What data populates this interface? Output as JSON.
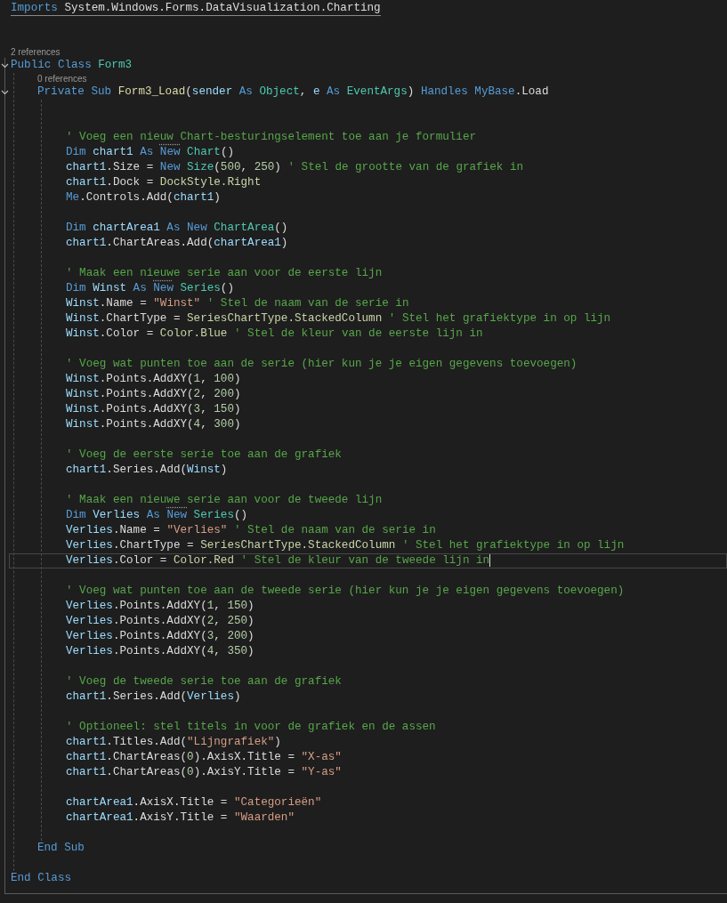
{
  "editor": {
    "lines": [
      {
        "kind": "import",
        "current": false,
        "tokens": [
          {
            "text": "Imports",
            "kind": "kw"
          },
          {
            "text": " System.Windows.Forms.DataVisualization.Charting",
            "kind": "plain"
          }
        ]
      },
      {
        "kind": "blank"
      },
      {
        "kind": "blank"
      },
      {
        "kind": "lens",
        "text": "2 references"
      },
      {
        "kind": "code",
        "current": false,
        "expanded": true,
        "tokens": [
          {
            "text": "Public Class ",
            "kind": "kw"
          },
          {
            "text": "Form3",
            "kind": "type"
          }
        ],
        "end": {
          "current": false,
          "tokens": [
            {
              "text": "End Class",
              "kind": "kw"
            }
          ]
        },
        "children": [
          {
            "kind": "lens",
            "text": "0 references"
          },
          {
            "kind": "code",
            "current": false,
            "expanded": true,
            "tokens": [
              {
                "text": "Private Sub ",
                "kind": "kw"
              },
              {
                "text": "Form3_Load",
                "kind": "fn"
              },
              {
                "text": "(",
                "kind": "plain"
              },
              {
                "text": "sender",
                "kind": "var"
              },
              {
                "text": " As ",
                "kind": "kw"
              },
              {
                "text": "Object",
                "kind": "type"
              },
              {
                "text": ", ",
                "kind": "plain"
              },
              {
                "text": "e",
                "kind": "var"
              },
              {
                "text": " As ",
                "kind": "kw"
              },
              {
                "text": "EventArgs",
                "kind": "type"
              },
              {
                "text": ") ",
                "kind": "plain"
              },
              {
                "text": "Handles MyBase",
                "kind": "kw"
              },
              {
                "text": ".Load",
                "kind": "plain"
              }
            ],
            "end": {
              "current": false,
              "tokens": [
                {
                  "text": "End Sub",
                  "kind": "kw"
                }
              ]
            },
            "children": [
              {
                "kind": "blank"
              },
              {
                "kind": "blank"
              },
              {
                "kind": "code",
                "current": false,
                "tokens": [
                  {
                    "text": "' Voeg een nieuw Chart-besturingselement toe aan je formulier",
                    "kind": "comment"
                  }
                ]
              },
              {
                "kind": "code",
                "current": false,
                "tokens": [
                  {
                    "text": "Dim ",
                    "kind": "kw"
                  },
                  {
                    "text": "chart1",
                    "kind": "var"
                  },
                  {
                    "text": " As ",
                    "kind": "kw"
                  },
                  {
                    "text": "New",
                    "kind": "hint"
                  },
                  {
                    "text": " Chart",
                    "kind": "type"
                  },
                  {
                    "text": "()",
                    "kind": "plain"
                  }
                ]
              },
              {
                "kind": "code",
                "current": false,
                "tokens": [
                  {
                    "text": "chart1",
                    "kind": "var"
                  },
                  {
                    "text": ".Size = ",
                    "kind": "plain"
                  },
                  {
                    "text": "New ",
                    "kind": "kw"
                  },
                  {
                    "text": "Size",
                    "kind": "type"
                  },
                  {
                    "text": "(",
                    "kind": "plain"
                  },
                  {
                    "text": "500",
                    "kind": "num"
                  },
                  {
                    "text": ", ",
                    "kind": "plain"
                  },
                  {
                    "text": "250",
                    "kind": "num"
                  },
                  {
                    "text": ") ",
                    "kind": "plain"
                  },
                  {
                    "text": "' Stel de grootte van de grafiek in",
                    "kind": "comment"
                  }
                ]
              },
              {
                "kind": "code",
                "current": false,
                "tokens": [
                  {
                    "text": "chart1",
                    "kind": "var"
                  },
                  {
                    "text": ".Dock = ",
                    "kind": "plain"
                  },
                  {
                    "text": "DockStyle.Right",
                    "kind": "enum"
                  }
                ]
              },
              {
                "kind": "code",
                "current": false,
                "tokens": [
                  {
                    "text": "Me",
                    "kind": "kw"
                  },
                  {
                    "text": ".Controls.Add(",
                    "kind": "plain"
                  },
                  {
                    "text": "chart1",
                    "kind": "var"
                  },
                  {
                    "text": ")",
                    "kind": "plain"
                  }
                ]
              },
              {
                "kind": "blank"
              },
              {
                "kind": "code",
                "current": false,
                "tokens": [
                  {
                    "text": "Dim ",
                    "kind": "kw"
                  },
                  {
                    "text": "chartArea1",
                    "kind": "var"
                  },
                  {
                    "text": " As New ",
                    "kind": "kw"
                  },
                  {
                    "text": "ChartArea",
                    "kind": "type"
                  },
                  {
                    "text": "()",
                    "kind": "plain"
                  }
                ]
              },
              {
                "kind": "code",
                "current": false,
                "tokens": [
                  {
                    "text": "chart1",
                    "kind": "var"
                  },
                  {
                    "text": ".ChartAreas.Add(",
                    "kind": "plain"
                  },
                  {
                    "text": "chartArea1",
                    "kind": "var"
                  },
                  {
                    "text": ")",
                    "kind": "plain"
                  }
                ]
              },
              {
                "kind": "blank"
              },
              {
                "kind": "code",
                "current": false,
                "tokens": [
                  {
                    "text": "' Maak een nieuwe serie aan voor de eerste lijn",
                    "kind": "comment"
                  }
                ]
              },
              {
                "kind": "code",
                "current": false,
                "tokens": [
                  {
                    "text": "Dim ",
                    "kind": "kw"
                  },
                  {
                    "text": "Winst",
                    "kind": "var"
                  },
                  {
                    "text": " As ",
                    "kind": "kw"
                  },
                  {
                    "text": "New",
                    "kind": "hint"
                  },
                  {
                    "text": " Series",
                    "kind": "type"
                  },
                  {
                    "text": "()",
                    "kind": "plain"
                  }
                ]
              },
              {
                "kind": "code",
                "current": false,
                "tokens": [
                  {
                    "text": "Winst",
                    "kind": "var"
                  },
                  {
                    "text": ".Name = ",
                    "kind": "plain"
                  },
                  {
                    "text": "\"Winst\"",
                    "kind": "str"
                  },
                  {
                    "text": " ' Stel de naam van de serie in",
                    "kind": "comment"
                  }
                ]
              },
              {
                "kind": "code",
                "current": false,
                "tokens": [
                  {
                    "text": "Winst",
                    "kind": "var"
                  },
                  {
                    "text": ".ChartType = ",
                    "kind": "plain"
                  },
                  {
                    "text": "SeriesChartType.StackedColumn",
                    "kind": "enum"
                  },
                  {
                    "text": " ' Stel het grafiektype in op lijn",
                    "kind": "comment"
                  }
                ]
              },
              {
                "kind": "code",
                "current": false,
                "tokens": [
                  {
                    "text": "Winst",
                    "kind": "var"
                  },
                  {
                    "text": ".Color = ",
                    "kind": "plain"
                  },
                  {
                    "text": "Color.Blue",
                    "kind": "enum"
                  },
                  {
                    "text": " ' Stel de kleur van de eerste lijn in",
                    "kind": "comment"
                  }
                ]
              },
              {
                "kind": "blank"
              },
              {
                "kind": "code",
                "current": false,
                "tokens": [
                  {
                    "text": "' Voeg wat punten toe aan de serie (hier kun je je eigen gegevens toevoegen)",
                    "kind": "comment"
                  }
                ]
              },
              {
                "kind": "code",
                "current": false,
                "tokens": [
                  {
                    "text": "Winst",
                    "kind": "var"
                  },
                  {
                    "text": ".Points.AddXY(",
                    "kind": "plain"
                  },
                  {
                    "text": "1",
                    "kind": "num"
                  },
                  {
                    "text": ", ",
                    "kind": "plain"
                  },
                  {
                    "text": "100",
                    "kind": "num"
                  },
                  {
                    "text": ")",
                    "kind": "plain"
                  }
                ]
              },
              {
                "kind": "code",
                "current": false,
                "tokens": [
                  {
                    "text": "Winst",
                    "kind": "var"
                  },
                  {
                    "text": ".Points.AddXY(",
                    "kind": "plain"
                  },
                  {
                    "text": "2",
                    "kind": "num"
                  },
                  {
                    "text": ", ",
                    "kind": "plain"
                  },
                  {
                    "text": "200",
                    "kind": "num"
                  },
                  {
                    "text": ")",
                    "kind": "plain"
                  }
                ]
              },
              {
                "kind": "code",
                "current": false,
                "tokens": [
                  {
                    "text": "Winst",
                    "kind": "var"
                  },
                  {
                    "text": ".Points.AddXY(",
                    "kind": "plain"
                  },
                  {
                    "text": "3",
                    "kind": "num"
                  },
                  {
                    "text": ", ",
                    "kind": "plain"
                  },
                  {
                    "text": "150",
                    "kind": "num"
                  },
                  {
                    "text": ")",
                    "kind": "plain"
                  }
                ]
              },
              {
                "kind": "code",
                "current": false,
                "tokens": [
                  {
                    "text": "Winst",
                    "kind": "var"
                  },
                  {
                    "text": ".Points.AddXY(",
                    "kind": "plain"
                  },
                  {
                    "text": "4",
                    "kind": "num"
                  },
                  {
                    "text": ", ",
                    "kind": "plain"
                  },
                  {
                    "text": "300",
                    "kind": "num"
                  },
                  {
                    "text": ")",
                    "kind": "plain"
                  }
                ]
              },
              {
                "kind": "blank"
              },
              {
                "kind": "code",
                "current": false,
                "tokens": [
                  {
                    "text": "' Voeg de eerste serie toe aan de grafiek",
                    "kind": "comment"
                  }
                ]
              },
              {
                "kind": "code",
                "current": false,
                "tokens": [
                  {
                    "text": "chart1",
                    "kind": "var"
                  },
                  {
                    "text": ".Series.Add(",
                    "kind": "plain"
                  },
                  {
                    "text": "Winst",
                    "kind": "var"
                  },
                  {
                    "text": ")",
                    "kind": "plain"
                  }
                ]
              },
              {
                "kind": "blank"
              },
              {
                "kind": "code",
                "current": false,
                "tokens": [
                  {
                    "text": "' Maak een nieuwe serie aan voor de tweede lijn",
                    "kind": "comment"
                  }
                ]
              },
              {
                "kind": "code",
                "current": false,
                "tokens": [
                  {
                    "text": "Dim ",
                    "kind": "kw"
                  },
                  {
                    "text": "Verlies",
                    "kind": "var"
                  },
                  {
                    "text": " As ",
                    "kind": "kw"
                  },
                  {
                    "text": "New",
                    "kind": "hint"
                  },
                  {
                    "text": " Series",
                    "kind": "type"
                  },
                  {
                    "text": "()",
                    "kind": "plain"
                  }
                ]
              },
              {
                "kind": "code",
                "current": false,
                "tokens": [
                  {
                    "text": "Verlies",
                    "kind": "var"
                  },
                  {
                    "text": ".Name = ",
                    "kind": "plain"
                  },
                  {
                    "text": "\"Verlies\"",
                    "kind": "str"
                  },
                  {
                    "text": " ' Stel de naam van de serie in",
                    "kind": "comment"
                  }
                ]
              },
              {
                "kind": "code",
                "current": false,
                "tokens": [
                  {
                    "text": "Verlies",
                    "kind": "var"
                  },
                  {
                    "text": ".ChartType = ",
                    "kind": "plain"
                  },
                  {
                    "text": "SeriesChartType.StackedColumn",
                    "kind": "enum"
                  },
                  {
                    "text": " ' Stel het grafiektype in op lijn",
                    "kind": "comment"
                  }
                ]
              },
              {
                "kind": "code",
                "current": true,
                "tokens": [
                  {
                    "text": "Verlies",
                    "kind": "var"
                  },
                  {
                    "text": ".Color = ",
                    "kind": "plain"
                  },
                  {
                    "text": "Color.Red",
                    "kind": "enum"
                  },
                  {
                    "text": " ' Stel de kleur van de tweede lijn in",
                    "kind": "comment"
                  }
                ]
              },
              {
                "kind": "blank"
              },
              {
                "kind": "code",
                "current": false,
                "tokens": [
                  {
                    "text": "' Voeg wat punten toe aan de tweede serie (hier kun je je eigen gegevens toevoegen)",
                    "kind": "comment"
                  }
                ]
              },
              {
                "kind": "code",
                "current": false,
                "tokens": [
                  {
                    "text": "Verlies",
                    "kind": "var"
                  },
                  {
                    "text": ".Points.AddXY(",
                    "kind": "plain"
                  },
                  {
                    "text": "1",
                    "kind": "num"
                  },
                  {
                    "text": ", ",
                    "kind": "plain"
                  },
                  {
                    "text": "150",
                    "kind": "num"
                  },
                  {
                    "text": ")",
                    "kind": "plain"
                  }
                ]
              },
              {
                "kind": "code",
                "current": false,
                "tokens": [
                  {
                    "text": "Verlies",
                    "kind": "var"
                  },
                  {
                    "text": ".Points.AddXY(",
                    "kind": "plain"
                  },
                  {
                    "text": "2",
                    "kind": "num"
                  },
                  {
                    "text": ", ",
                    "kind": "plain"
                  },
                  {
                    "text": "250",
                    "kind": "num"
                  },
                  {
                    "text": ")",
                    "kind": "plain"
                  }
                ]
              },
              {
                "kind": "code",
                "current": false,
                "tokens": [
                  {
                    "text": "Verlies",
                    "kind": "var"
                  },
                  {
                    "text": ".Points.AddXY(",
                    "kind": "plain"
                  },
                  {
                    "text": "3",
                    "kind": "num"
                  },
                  {
                    "text": ", ",
                    "kind": "plain"
                  },
                  {
                    "text": "200",
                    "kind": "num"
                  },
                  {
                    "text": ")",
                    "kind": "plain"
                  }
                ]
              },
              {
                "kind": "code",
                "current": false,
                "tokens": [
                  {
                    "text": "Verlies",
                    "kind": "var"
                  },
                  {
                    "text": ".Points.AddXY(",
                    "kind": "plain"
                  },
                  {
                    "text": "4",
                    "kind": "num"
                  },
                  {
                    "text": ", ",
                    "kind": "plain"
                  },
                  {
                    "text": "350",
                    "kind": "num"
                  },
                  {
                    "text": ")",
                    "kind": "plain"
                  }
                ]
              },
              {
                "kind": "blank"
              },
              {
                "kind": "code",
                "current": false,
                "tokens": [
                  {
                    "text": "' Voeg de tweede serie toe aan de grafiek",
                    "kind": "comment"
                  }
                ]
              },
              {
                "kind": "code",
                "current": false,
                "tokens": [
                  {
                    "text": "chart1",
                    "kind": "var"
                  },
                  {
                    "text": ".Series.Add(",
                    "kind": "plain"
                  },
                  {
                    "text": "Verlies",
                    "kind": "var"
                  },
                  {
                    "text": ")",
                    "kind": "plain"
                  }
                ]
              },
              {
                "kind": "blank"
              },
              {
                "kind": "code",
                "current": false,
                "tokens": [
                  {
                    "text": "' Optioneel: stel titels in voor de grafiek en de assen",
                    "kind": "comment"
                  }
                ]
              },
              {
                "kind": "code",
                "current": false,
                "tokens": [
                  {
                    "text": "chart1",
                    "kind": "var"
                  },
                  {
                    "text": ".Titles.Add(",
                    "kind": "plain"
                  },
                  {
                    "text": "\"Lijngrafiek\"",
                    "kind": "str"
                  },
                  {
                    "text": ")",
                    "kind": "plain"
                  }
                ]
              },
              {
                "kind": "code",
                "current": false,
                "tokens": [
                  {
                    "text": "chart1",
                    "kind": "var"
                  },
                  {
                    "text": ".ChartAreas(",
                    "kind": "plain"
                  },
                  {
                    "text": "0",
                    "kind": "num"
                  },
                  {
                    "text": ").AxisX.Title = ",
                    "kind": "plain"
                  },
                  {
                    "text": "\"X-as\"",
                    "kind": "str"
                  }
                ]
              },
              {
                "kind": "code",
                "current": false,
                "tokens": [
                  {
                    "text": "chart1",
                    "kind": "var"
                  },
                  {
                    "text": ".ChartAreas(",
                    "kind": "plain"
                  },
                  {
                    "text": "0",
                    "kind": "num"
                  },
                  {
                    "text": ").AxisY.Title = ",
                    "kind": "plain"
                  },
                  {
                    "text": "\"Y-as\"",
                    "kind": "str"
                  }
                ]
              },
              {
                "kind": "blank"
              },
              {
                "kind": "code",
                "current": false,
                "tokens": [
                  {
                    "text": "chartArea1",
                    "kind": "var"
                  },
                  {
                    "text": ".AxisX.Title = ",
                    "kind": "plain"
                  },
                  {
                    "text": "\"Categorieën\"",
                    "kind": "str"
                  }
                ]
              },
              {
                "kind": "code",
                "current": false,
                "tokens": [
                  {
                    "text": "chartArea1",
                    "kind": "var"
                  },
                  {
                    "text": ".AxisY.Title = ",
                    "kind": "plain"
                  },
                  {
                    "text": "\"Waarden\"",
                    "kind": "str"
                  }
                ]
              },
              {
                "kind": "blank"
              }
            ]
          },
          {
            "kind": "blank"
          }
        ]
      }
    ]
  }
}
